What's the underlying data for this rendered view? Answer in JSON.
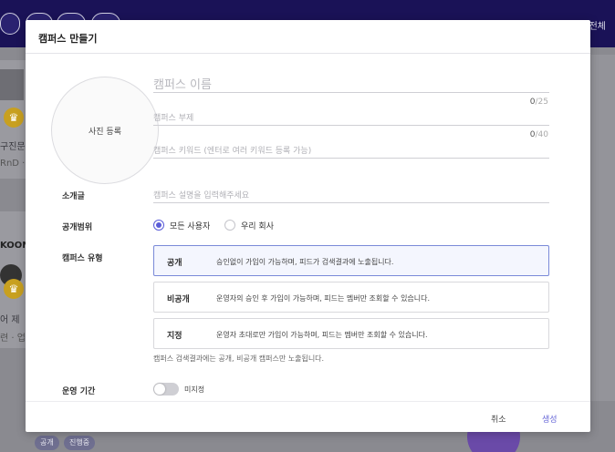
{
  "background": {
    "header_right": "전체",
    "left_texts": [
      "구진문 >",
      "RnD ·",
      "KOON",
      "어 제",
      "련 · 업"
    ],
    "tags": [
      "공개",
      "진행중"
    ]
  },
  "modal": {
    "title": "캠퍼스 만들기",
    "photo_label": "사진 등록",
    "name_placeholder": "캠퍼스 이름",
    "name_count": "0",
    "name_max": "/25",
    "sub_placeholder": "캠퍼스 부제",
    "sub_count": "0",
    "sub_max": "/40",
    "keyword_placeholder": "캠퍼스 키워드 (엔터로 여러 키워드 등록 가능)",
    "intro_label": "소개글",
    "intro_placeholder": "캠퍼스 설명을 입력해주세요",
    "visibility_label": "공개범위",
    "visibility_options": [
      "모든 사용자",
      "우리 회사"
    ],
    "visibility_selected": "모든 사용자",
    "type_label": "캠퍼스 유형",
    "types": [
      {
        "name": "공개",
        "desc": "승인없이 가입이 가능하며, 피드가 검색결과에 노출됩니다.",
        "selected": true
      },
      {
        "name": "비공개",
        "desc": "운영자의 승인 후 가입이 가능하며, 피드는 멤버만 조회할 수 있습니다.",
        "selected": false
      },
      {
        "name": "지정",
        "desc": "운영자 초대로만 가입이 가능하며, 피드는 멤버만 조회할 수 있습니다.",
        "selected": false
      }
    ],
    "type_note": "캠퍼스 검색결과에는 공개, 비공개 캠퍼스만 노출됩니다.",
    "period_label": "운영 기간",
    "period_toggle_label": "미지정",
    "period_toggle_on": false,
    "cancel_label": "취소",
    "create_label": "생성"
  },
  "colors": {
    "accent": "#5a5cd8",
    "header_bg": "#1a1257",
    "selected_border": "#7a8ad8"
  }
}
